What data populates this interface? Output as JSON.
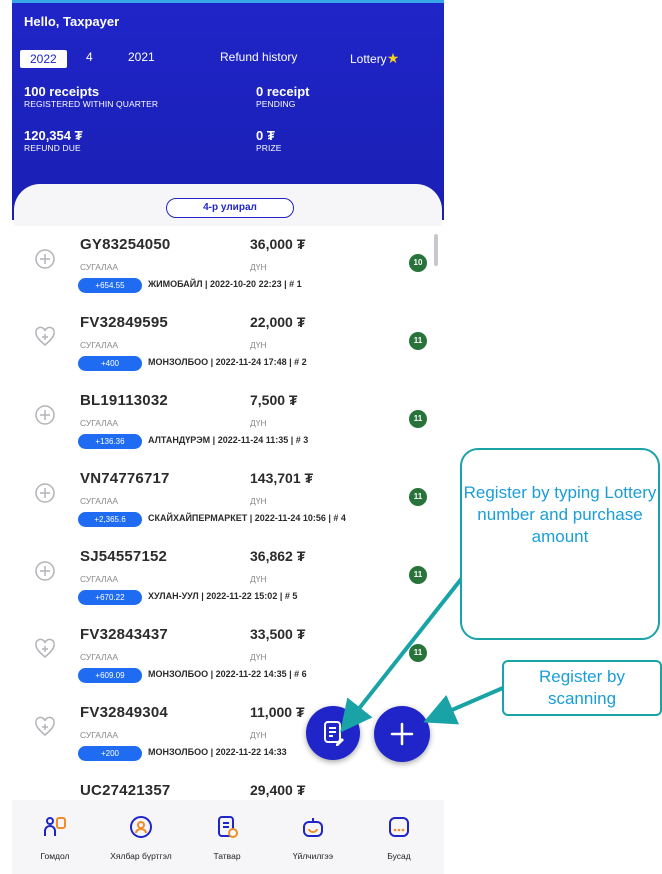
{
  "header": {
    "greeting": "Hello, Taxpayer",
    "tabs": {
      "year_active": "2022",
      "quarter": "4",
      "year_prev": "2021",
      "refund_history": "Refund history",
      "lottery": "Lottery"
    },
    "stats": {
      "receipts_value": "100 receipts",
      "receipts_label": "REGISTERED WITHIN QUARTER",
      "pending_value": "0 receipt",
      "pending_label": "PENDING",
      "refund_value": "120,354 ₮",
      "refund_label": "REFUND DUE",
      "prize_value": "0 ₮",
      "prize_label": "PRIZE"
    }
  },
  "quarter_pill": "4-р улирал",
  "receipts": [
    {
      "code": "GY83254050",
      "amount": "36,000 ₮",
      "code_label": "СУГАЛАА",
      "amount_label": "ДҮН",
      "chip": "+654.55",
      "meta": "ЖИМОБАЙЛ | 2022-10-20 22:23 | # 1",
      "badge": "10",
      "icon": "plus-circle-icon"
    },
    {
      "code": "FV32849595",
      "amount": "22,000 ₮",
      "code_label": "СУГАЛАА",
      "amount_label": "ДҮН",
      "chip": "+400",
      "meta": "МОНЗОЛБОО | 2022-11-24 17:48 | # 2",
      "badge": "11",
      "icon": "heart-plus-icon"
    },
    {
      "code": "BL19113032",
      "amount": "7,500 ₮",
      "code_label": "СУГАЛАА",
      "amount_label": "ДҮН",
      "chip": "+136.36",
      "meta": "АЛТАНДҮРЭМ | 2022-11-24 11:35 | # 3",
      "badge": "11",
      "icon": "plus-circle-icon"
    },
    {
      "code": "VN74776717",
      "amount": "143,701 ₮",
      "code_label": "СУГАЛАА",
      "amount_label": "ДҮН",
      "chip": "+2,365.6",
      "meta": "СКАЙХАЙПЕРМАРКЕТ | 2022-11-24 10:56 | # 4",
      "badge": "11",
      "icon": "plus-circle-icon"
    },
    {
      "code": "SJ54557152",
      "amount": "36,862 ₮",
      "code_label": "СУГАЛАА",
      "amount_label": "ДҮН",
      "chip": "+670.22",
      "meta": "ХУЛАН-УУЛ | 2022-11-22 15:02 | # 5",
      "badge": "11",
      "icon": "plus-circle-icon"
    },
    {
      "code": "FV32843437",
      "amount": "33,500 ₮",
      "code_label": "СУГАЛАА",
      "amount_label": "ДҮН",
      "chip": "+609.09",
      "meta": "МОНЗОЛБОО | 2022-11-22 14:35 | # 6",
      "badge": "11",
      "icon": "heart-plus-icon"
    },
    {
      "code": "FV32849304",
      "amount": "11,000 ₮",
      "code_label": "СУГАЛАА",
      "amount_label": "ДҮН",
      "chip": "+200",
      "meta": "МОНЗОЛБОО | 2022-11-22 14:33",
      "badge": "",
      "icon": "heart-plus-icon"
    },
    {
      "code": "UC27421357",
      "amount": "29,400 ₮",
      "code_label": "",
      "amount_label": "",
      "chip": "",
      "meta": "",
      "badge": "",
      "icon": ""
    }
  ],
  "bottom_nav": [
    {
      "label": "Гомдол",
      "icon": "complaint-icon"
    },
    {
      "label": "Хялбар бүртгэл",
      "icon": "easy-register-icon"
    },
    {
      "label": "Татвар",
      "icon": "tax-document-icon"
    },
    {
      "label": "Үйлчилгээ",
      "icon": "service-icon"
    },
    {
      "label": "Бусад",
      "icon": "more-icon"
    }
  ],
  "callouts": {
    "typing": "Register by typing Lottery number and purchase amount",
    "scanning": "Register by scanning"
  },
  "colors": {
    "brand_blue": "#1f25c8",
    "chip_blue": "#1f6cf2",
    "badge_green": "#28733a",
    "callout_teal": "#1aa3a7",
    "callout_text": "#1a9ed9",
    "star_yellow": "#f7d21c"
  }
}
